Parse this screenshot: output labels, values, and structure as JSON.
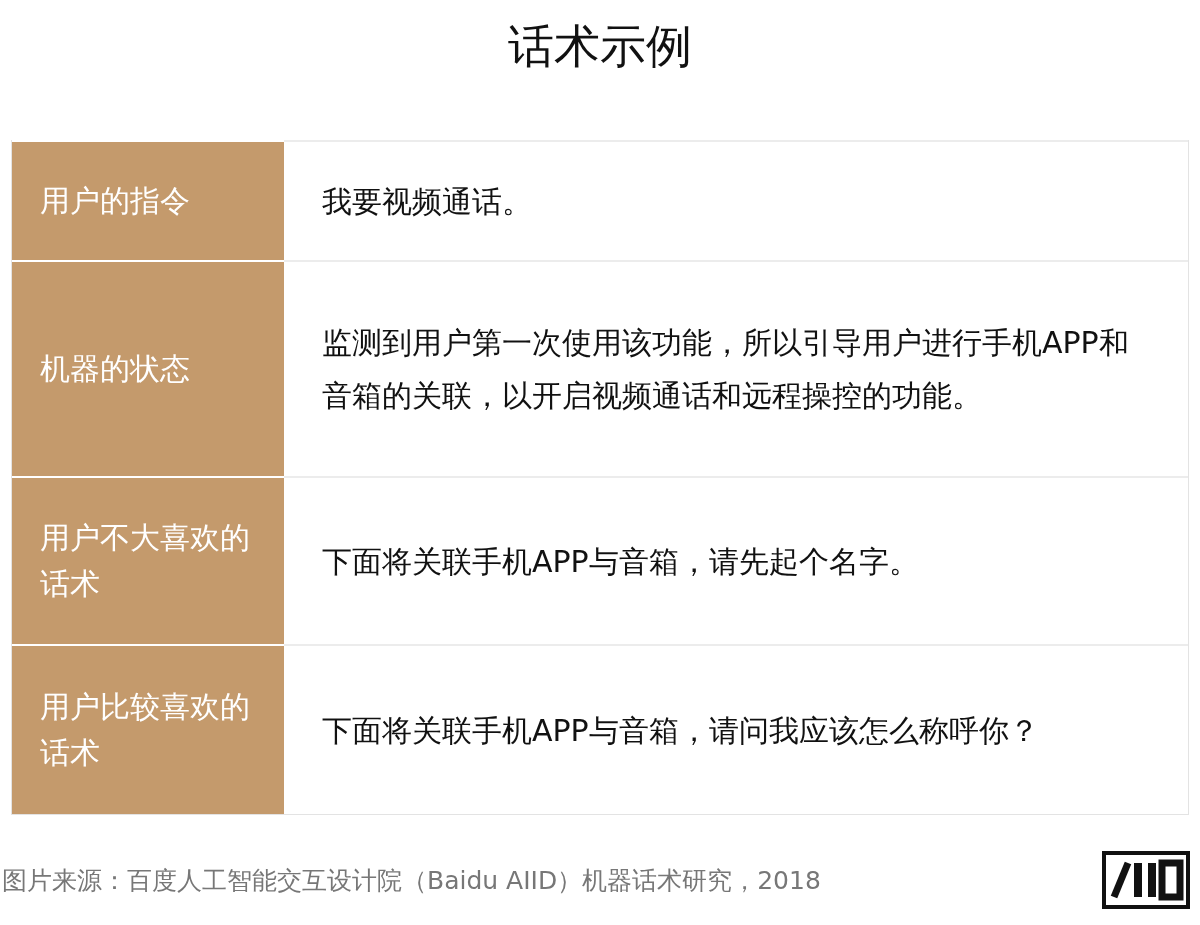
{
  "title": "话术示例",
  "rows": [
    {
      "label": "用户的指令",
      "content": "我要视频通话。"
    },
    {
      "label": "机器的状态",
      "content": "监测到用户第一次使用该功能，所以引导用户进行手机APP和音箱的关联，以开启视频通话和远程操控的功能。"
    },
    {
      "label": "用户不大喜欢的话术",
      "content": "下面将关联手机APP与音箱，请先起个名字。"
    },
    {
      "label": "用户比较喜欢的话术",
      "content": "下面将关联手机APP与音箱，请问我应该怎么称呼你？"
    }
  ],
  "footer": {
    "source": "图片来源：百度人工智能交互设计院（Baidu AIID）机器话术研究，2018"
  }
}
